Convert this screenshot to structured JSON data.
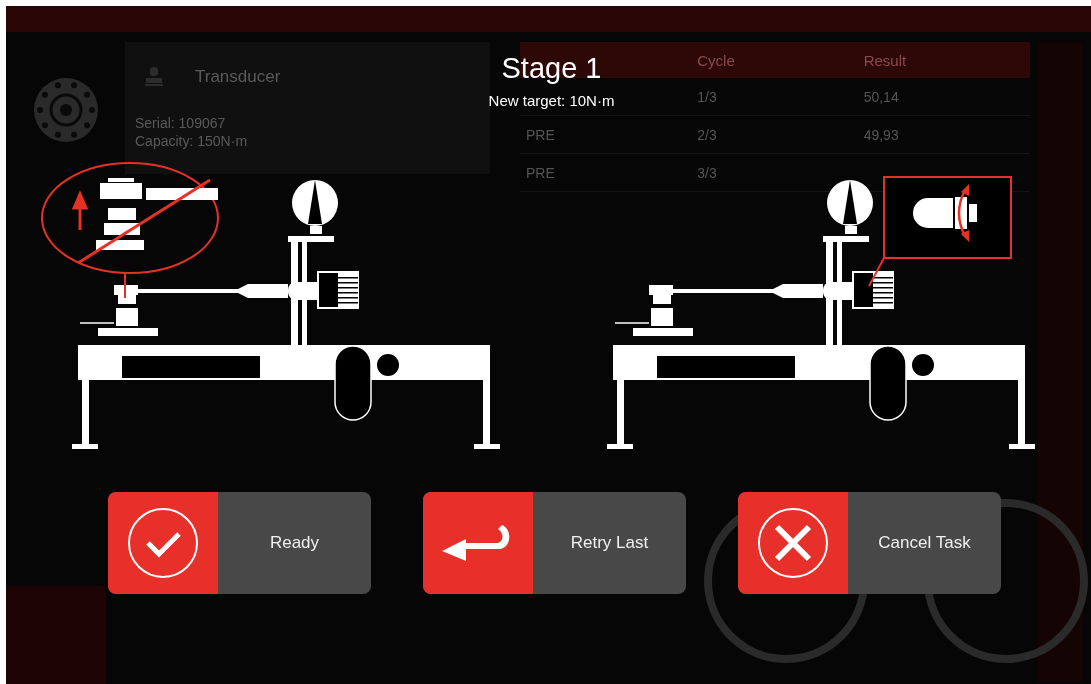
{
  "transducer_panel": {
    "title": "Transducer",
    "lines": [
      "Serial: 109067",
      "Capacity: 150N·m"
    ]
  },
  "results_table": {
    "columns": [
      "Cycle",
      "Result"
    ],
    "rows": [
      {
        "cycle": "1/3",
        "result": "50,14"
      },
      {
        "stage": "PRE",
        "cycle": "2/3",
        "result": "49,93"
      },
      {
        "stage": "PRE",
        "cycle": "3/3"
      }
    ]
  },
  "dialog": {
    "title": "Stage 1",
    "subtitle": "New target: 10N·m",
    "diagrams": [
      {
        "kind": "lift-warning"
      },
      {
        "kind": "bit-detail"
      }
    ],
    "buttons": [
      {
        "label": "Ready"
      },
      {
        "label": "Retry Last"
      },
      {
        "label": "Cancel Task"
      }
    ]
  }
}
